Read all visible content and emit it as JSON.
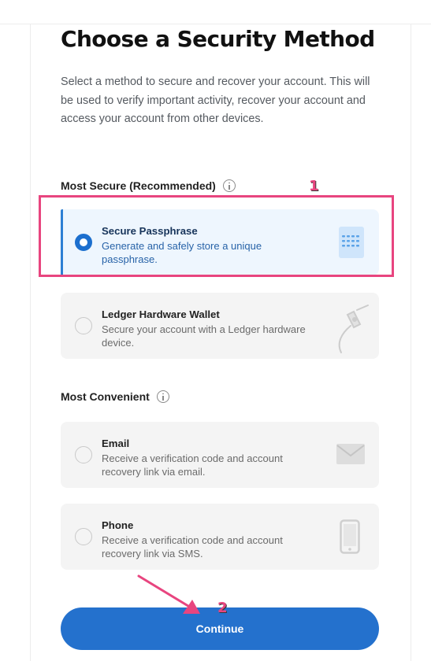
{
  "page": {
    "title": "Choose a Security Method",
    "description": "Select a method to secure and recover your account. This will be used to verify important activity, recover your account and access your account from other devices."
  },
  "sections": [
    {
      "label": "Most Secure (Recommended)",
      "info_icon": "info-icon",
      "options": [
        {
          "title": "Secure Passphrase",
          "description": "Generate and safely store a unique passphrase.",
          "selected": true,
          "icon": "passphrase-document-icon"
        },
        {
          "title": "Ledger Hardware Wallet",
          "description": "Secure your account with a Ledger hardware device.",
          "selected": false,
          "icon": "ledger-device-icon"
        }
      ]
    },
    {
      "label": "Most Convenient",
      "info_icon": "info-icon",
      "options": [
        {
          "title": "Email",
          "description": "Receive a verification code and account recovery link via email.",
          "selected": false,
          "icon": "envelope-icon"
        },
        {
          "title": "Phone",
          "description": "Receive a verification code and account recovery link via SMS.",
          "selected": false,
          "icon": "phone-icon"
        }
      ]
    }
  ],
  "continue_label": "Continue",
  "annotations": {
    "marker_1": "1",
    "marker_2": "2"
  },
  "colors": {
    "accent": "#2471cd",
    "selected_bg": "#eef6fe",
    "annotation": "#e8457f",
    "option_bg": "#f4f4f4"
  }
}
